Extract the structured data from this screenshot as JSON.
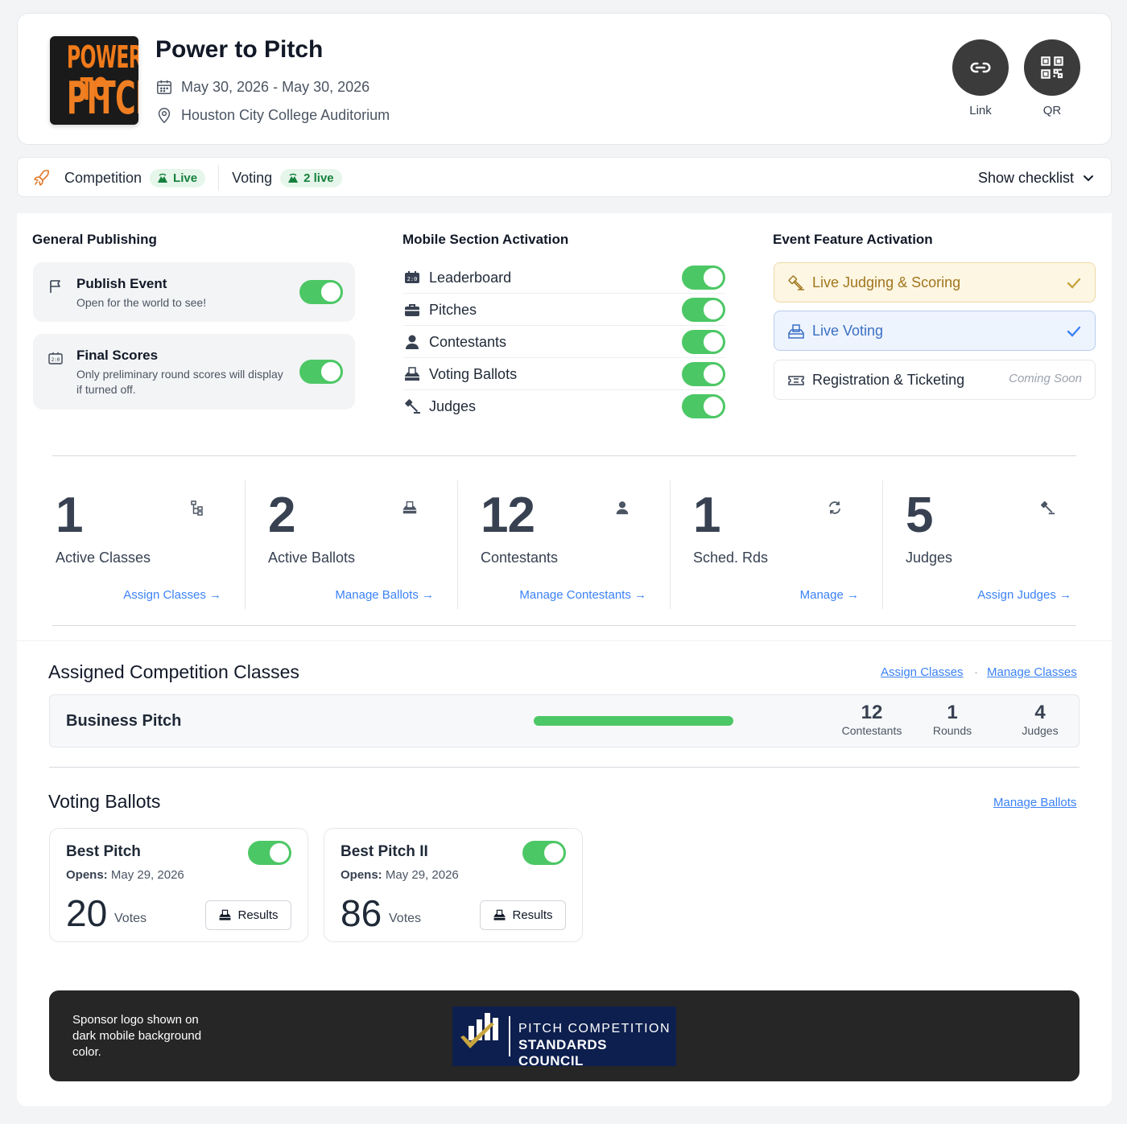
{
  "event": {
    "logo_text_top": "POWER TO",
    "logo_text_bottom": "PITCH",
    "title": "Power to Pitch",
    "dates": "May 30, 2026 - May 30, 2026",
    "location": "Houston City College Auditorium"
  },
  "header_actions": [
    {
      "label": "Link",
      "icon": "link-icon"
    },
    {
      "label": "QR",
      "icon": "qr-code-icon"
    }
  ],
  "status_bar": {
    "competition_label": "Competition",
    "competition_badge": "Live",
    "voting_label": "Voting",
    "voting_badge": "2 live",
    "checklist_label": "Show checklist"
  },
  "general_publishing": {
    "heading": "General Publishing",
    "items": [
      {
        "title": "Publish Event",
        "description": "Open for the world to see!",
        "enabled": true,
        "icon": "flag-icon"
      },
      {
        "title": "Final Scores",
        "description": "Only preliminary round scores will display if turned off.",
        "enabled": true,
        "icon": "scoreboard-icon"
      }
    ]
  },
  "mobile_sections": {
    "heading": "Mobile Section Activation",
    "items": [
      {
        "label": "Leaderboard",
        "enabled": true,
        "icon": "scoreboard-icon"
      },
      {
        "label": "Pitches",
        "enabled": true,
        "icon": "briefcase-icon"
      },
      {
        "label": "Contestants",
        "enabled": true,
        "icon": "user-icon"
      },
      {
        "label": "Voting Ballots",
        "enabled": true,
        "icon": "ballot-box-icon"
      },
      {
        "label": "Judges",
        "enabled": true,
        "icon": "gavel-icon"
      }
    ]
  },
  "feature_activation": {
    "heading": "Event Feature Activation",
    "items": [
      {
        "label": "Live Judging & Scoring",
        "status": "active",
        "icon": "gavel-icon",
        "color": "#a1761d"
      },
      {
        "label": "Live Voting",
        "status": "active",
        "icon": "ballot-box-icon",
        "color": "#3b6fc4"
      },
      {
        "label": "Registration & Ticketing",
        "status_text": "Coming Soon",
        "icon": "ticket-icon"
      }
    ]
  },
  "stats": [
    {
      "value": "1",
      "label": "Active Classes",
      "link": "Assign Classes →",
      "icon": "hierarchy-icon"
    },
    {
      "value": "2",
      "label": "Active Ballots",
      "link": "Manage Ballots →",
      "icon": "ballot-box-icon"
    },
    {
      "value": "12",
      "label": "Contestants",
      "link": "Manage Contestants →",
      "icon": "user-icon"
    },
    {
      "value": "1",
      "label": "Sched. Rds",
      "link": "Manage →",
      "icon": "refresh-icon"
    },
    {
      "value": "5",
      "label": "Judges",
      "link": "Assign Judges →",
      "icon": "gavel-icon"
    }
  ],
  "assigned_classes": {
    "heading": "Assigned Competition Classes",
    "link_assign": "Assign Classes",
    "link_separator": "·",
    "link_manage": "Manage Classes",
    "rows": [
      {
        "name": "Business Pitch",
        "progress": 1.0,
        "contestants": "12",
        "contestants_label": "Contestants",
        "rounds": "1",
        "rounds_label": "Rounds",
        "judges": "4",
        "judges_label": "Judges"
      }
    ]
  },
  "voting_ballots": {
    "heading": "Voting Ballots",
    "link_manage": "Manage Ballots",
    "items": [
      {
        "name": "Best Pitch",
        "opens_label": "Opens:",
        "opens_date": "May 29, 2026",
        "votes": "20",
        "votes_label": "Votes",
        "results_label": "Results",
        "enabled": true
      },
      {
        "name": "Best Pitch II",
        "opens_label": "Opens:",
        "opens_date": "May 29, 2026",
        "votes": "86",
        "votes_label": "Votes",
        "results_label": "Results",
        "enabled": true
      }
    ]
  },
  "sponsor": {
    "note": "Sponsor logo shown on dark mobile background color.",
    "logo_line1": "PITCH COMPETITION",
    "logo_line2": "STANDARDS COUNCIL"
  },
  "colors": {
    "toggle_on": "#4cc765",
    "link": "#3b82f6",
    "live_badge_bg": "#e6f6ea",
    "live_badge_text": "#15803d",
    "judging_bg": "#fdf6e3",
    "voting_bg": "#eef4fd"
  }
}
